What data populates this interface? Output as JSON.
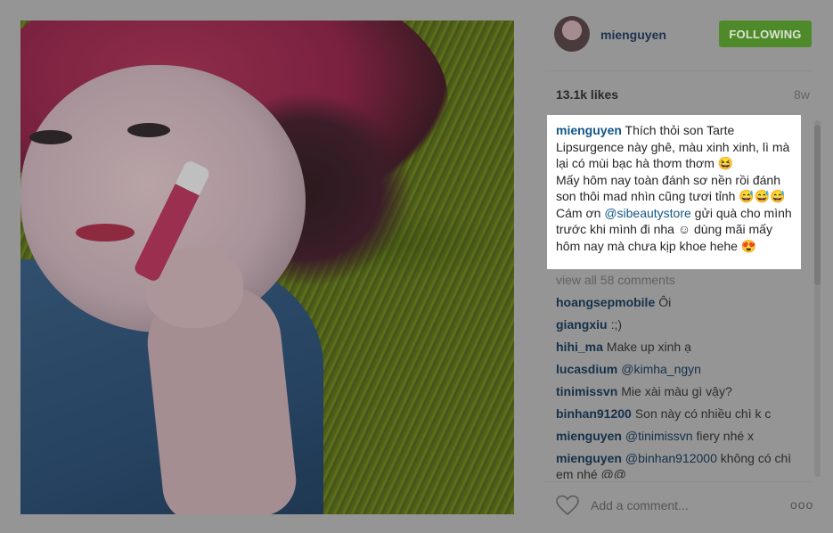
{
  "post": {
    "username": "mienguyen",
    "follow_label": "FOLLOWING",
    "likes": "13.1k likes",
    "age": "8w"
  },
  "caption": {
    "username": "mienguyen",
    "text1": " Thích thỏi son Tarte Lipsurgence này ghê, màu xinh xinh, lì mà lại có mùi bạc hà thơm thơm 😆",
    "text2": "Mấy hôm nay toàn đánh sơ nền rồi đánh son thôi mad nhìn cũng tươi tỉnh 😅😅😅",
    "text3a": "Cám ơn ",
    "mention": "@sibeautystore",
    "text3b": " gửi quà cho mình trước khi mình đi nha ☺ dùng mãi mấy hôm nay mà chưa kịp khoe hehe 😍"
  },
  "view_all": "view all 58 comments",
  "comments": [
    {
      "user": "hoangsepmobile",
      "mention": "",
      "text": "Ôi"
    },
    {
      "user": "giangxiu",
      "mention": "",
      "text": ":;)"
    },
    {
      "user": "hihi_ma",
      "mention": "",
      "text": "Make up xinh ạ"
    },
    {
      "user": "lucasdium",
      "mention": "@kimha_ngyn",
      "text": ""
    },
    {
      "user": "tinimissvn",
      "mention": "",
      "text": "Mie xài màu gì vậy?"
    },
    {
      "user": "binhan91200",
      "mention": "",
      "text": "Son này có nhiều chì k c"
    },
    {
      "user": "mienguyen",
      "mention": "@tinimissvn",
      "text": " fiery nhé x"
    },
    {
      "user": "mienguyen",
      "mention": "@binhan912000",
      "text": " không có chì em nhé @@"
    }
  ],
  "footer": {
    "placeholder": "Add a comment...",
    "more": "ooo"
  },
  "icons": {
    "heart": "heart-icon",
    "more": "more-options-icon"
  }
}
